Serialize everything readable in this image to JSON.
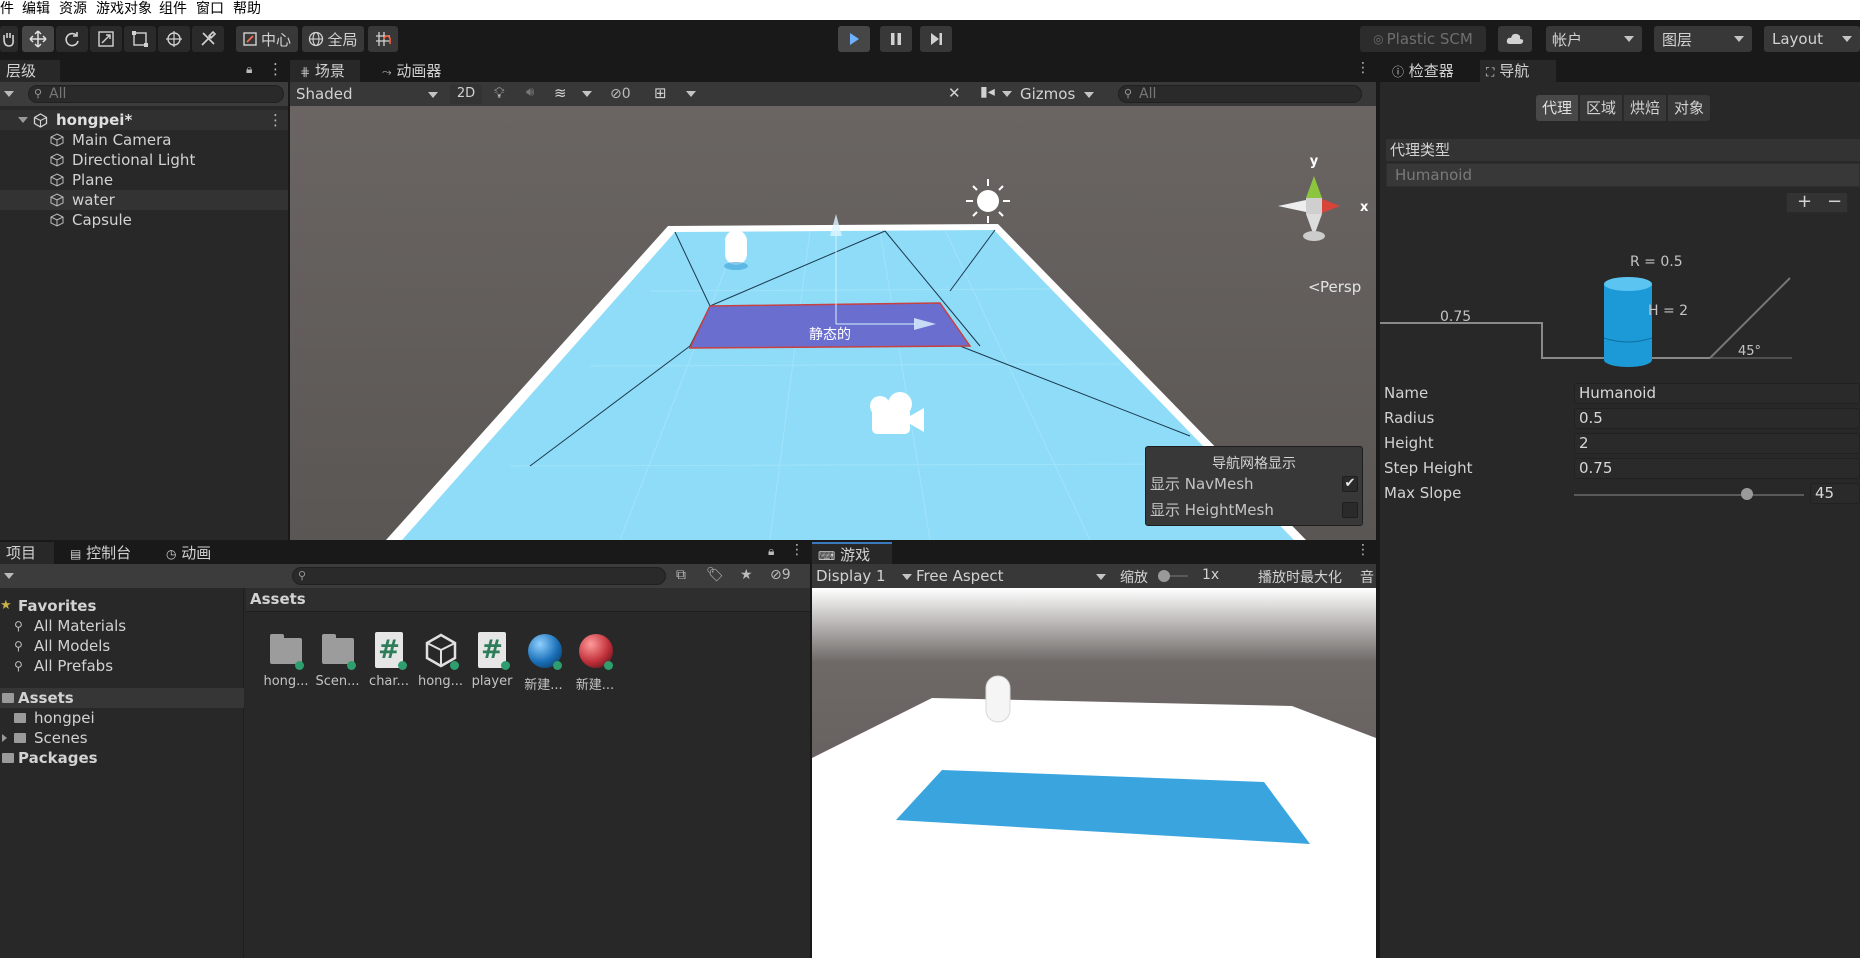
{
  "menu": [
    "件",
    "编辑",
    "资源",
    "游戏对象",
    "组件",
    "窗口",
    "帮助"
  ],
  "toolbar": {
    "center_label": "中心",
    "global_label": "全局",
    "plastic_label": "Plastic SCM",
    "account_label": "帐户",
    "layers_label": "图层",
    "layout_label": "Layout"
  },
  "hierarchy": {
    "tab_label": "层级",
    "search_placeholder": "All",
    "scene_name": "hongpei*",
    "items": [
      "Main Camera",
      "Directional Light",
      "Plane",
      "water",
      "Capsule"
    ]
  },
  "scene": {
    "tab_scene": "场景",
    "tab_animator": "动画器",
    "shading_mode": "Shaded",
    "mode_2d": "2D",
    "hidden_count": "0",
    "gizmos_label": "Gizmos",
    "search_placeholder": "All",
    "persp_label": "Persp",
    "axis_y": "y",
    "axis_x": "x",
    "static_label": "静态的"
  },
  "navmesh_display": {
    "title": "导航网格显示",
    "show_navmesh": "显示 NavMesh",
    "show_navmesh_checked": true,
    "show_heightmesh": "显示 HeightMesh",
    "show_heightmesh_checked": false
  },
  "inspector": {
    "tab_inspector": "检查器",
    "tab_navigation": "导航",
    "subtabs": [
      "代理",
      "区域",
      "烘焙",
      "对象"
    ],
    "agent_type_label": "代理类型",
    "agent_type_value": "Humanoid",
    "plus": "+",
    "minus": "−",
    "diagram": {
      "radius_label": "R = 0.5",
      "height_label": "H = 2",
      "step_label": "0.75",
      "slope_label": "45°"
    },
    "fields": [
      {
        "label": "Name",
        "value": "Humanoid"
      },
      {
        "label": "Radius",
        "value": "0.5"
      },
      {
        "label": "Height",
        "value": "2"
      },
      {
        "label": "Step Height",
        "value": "0.75"
      }
    ],
    "max_slope_label": "Max Slope",
    "max_slope_value": "45",
    "max_slope_fraction": 0.75
  },
  "project": {
    "tab_project": "项目",
    "tab_console": "控制台",
    "tab_animation": "动画",
    "hidden_count": "9",
    "favorites_label": "Favorites",
    "favorites": [
      "All Materials",
      "All Models",
      "All Prefabs"
    ],
    "assets_label": "Assets",
    "asset_folders": [
      "hongpei",
      "Scenes"
    ],
    "packages_label": "Packages",
    "breadcrumb": "Assets",
    "assets": [
      {
        "name": "hong...",
        "kind": "folder"
      },
      {
        "name": "Scen...",
        "kind": "folder"
      },
      {
        "name": "char...",
        "kind": "script"
      },
      {
        "name": "hong...",
        "kind": "unity"
      },
      {
        "name": "player",
        "kind": "script"
      },
      {
        "name": "新建...",
        "kind": "material-blue"
      },
      {
        "name": "新建...",
        "kind": "material-red"
      }
    ]
  },
  "game": {
    "tab_label": "游戏",
    "display": "Display 1",
    "aspect": "Free Aspect",
    "scale_label": "缩放",
    "scale_value": "1x",
    "maximize_label": "播放时最大化",
    "audio_label": "音"
  },
  "colors": {
    "accent_blue": "#3a79bb",
    "navmesh": "#8fdcf8",
    "static_obstacle": "#6a6fcf"
  }
}
